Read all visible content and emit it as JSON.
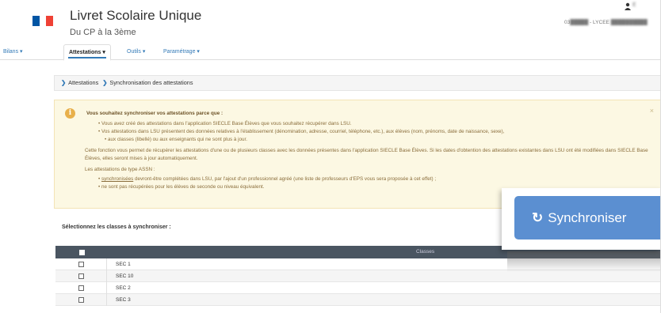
{
  "header": {
    "app_title": "Livret Scolaire Unique",
    "subtitle": "Du CP à la 3ème",
    "user_name": "E              ",
    "etab_code": "03",
    "etab_sep": " - LYCEE "
  },
  "nav": {
    "items": [
      {
        "label": "Bilans ▾"
      },
      {
        "label": "Attestations ▾"
      },
      {
        "label": "Outils ▾"
      },
      {
        "label": "Paramétrage ▾"
      }
    ]
  },
  "breadcrumb": {
    "item1": "Attestations",
    "item2": "Synchronisation des attestations"
  },
  "alert": {
    "heading": "Vous souhaitez synchroniser vos attestations parce que :",
    "bullet1": "Vous avez créé des attestations dans l'application SIECLE Base Élèves que vous souhaitez récupérer dans LSU.",
    "bullet2a": "Vos attestations dans LSU présentent des données relatives à l'établissement (dénomination, adresse, courriel, téléphone, etc.), aux élèves (nom, prénoms, date de naissance, sexe),",
    "bullet2b": "aux classes (libellé) ou aux enseignants qui ne sont plus à jour.",
    "para1": "Cette fonction vous permet de récupérer les attestations d'une ou de plusieurs classes avec les données présentes dans l'application SIECLE Base Élèves. Si les dates d'obtention des attestations existantes dans LSU ont été modifiées dans SIECLE Base Élèves, elles seront mises à jour automatiquement.",
    "para2": "Les attestations de type ASSN :",
    "assn_link": "synchronisées",
    "assn_rest": " devront-être complétées dans LSU, par l'ajout d'un professionnel agréé (une liste de professeurs d'EPS vous sera proposée à cet effet) ;",
    "assn_bullet2": "ne sont pas récupérées pour les élèves de seconde ou niveau équivalent.",
    "close": "×"
  },
  "selection_label": "Sélectionnez les classes à synchroniser :",
  "table": {
    "header_classes": "Classes",
    "rows": [
      {
        "label": "SEC 1"
      },
      {
        "label": "SEC 10"
      },
      {
        "label": "SEC 2"
      },
      {
        "label": "SEC 3"
      }
    ]
  },
  "sync_button": {
    "icon": "refresh-icon",
    "label": "Synchroniser"
  },
  "colors": {
    "flag_blue": "#0055a4",
    "flag_white": "#ffffff",
    "flag_red": "#ef4135",
    "link_blue": "#337ab7",
    "alert_bg": "#fcf8e3",
    "table_header": "#4a5561",
    "sync_button": "#5b8fd1"
  }
}
